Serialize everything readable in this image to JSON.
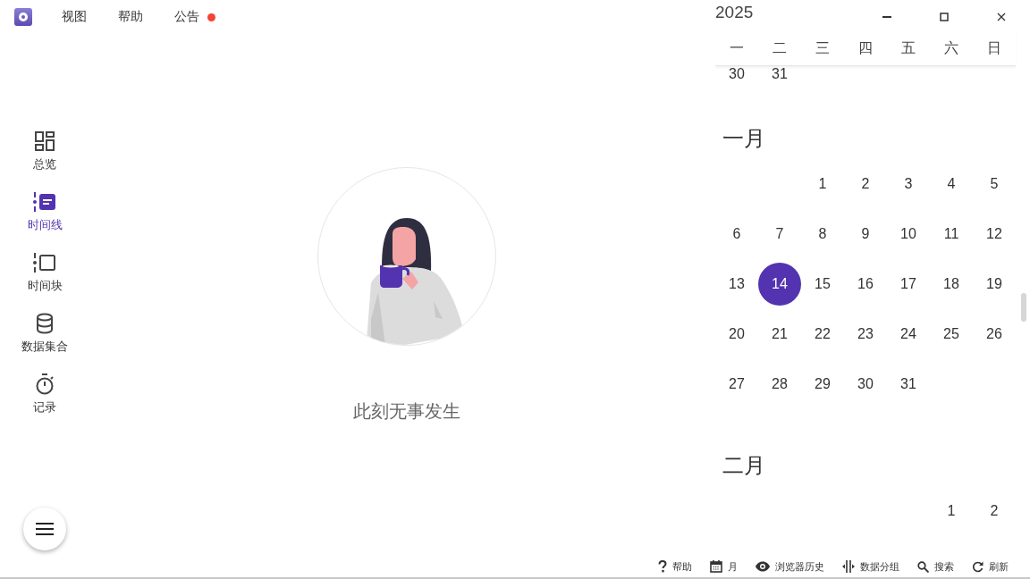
{
  "app_bar": {
    "menus": [
      {
        "label": "视图",
        "unread": false
      },
      {
        "label": "帮助",
        "unread": false
      },
      {
        "label": "公告",
        "unread": true
      }
    ]
  },
  "sidebar": {
    "items": [
      {
        "label": "总览",
        "selected": false
      },
      {
        "label": "时间线",
        "selected": true
      },
      {
        "label": "时间块",
        "selected": false
      },
      {
        "label": "数据集合",
        "selected": false
      },
      {
        "label": "记录",
        "selected": false
      }
    ]
  },
  "empty_state": {
    "message": "此刻无事发生"
  },
  "calendar": {
    "year": "2025",
    "weekdays": [
      "一",
      "二",
      "三",
      "四",
      "五",
      "六",
      "日"
    ],
    "leading_days": [
      {
        "day": "30",
        "selected": false
      },
      {
        "day": "31",
        "selected": false
      }
    ],
    "months": [
      {
        "name": "一月",
        "weeks": [
          [
            {
              "day": "1",
              "selected": false
            },
            {
              "day": "2",
              "selected": false
            },
            {
              "day": "3",
              "selected": false
            },
            {
              "day": "4",
              "selected": false
            },
            {
              "day": "5",
              "selected": false
            }
          ],
          [
            {
              "day": "6",
              "selected": false
            },
            {
              "day": "7",
              "selected": false
            },
            {
              "day": "8",
              "selected": false
            },
            {
              "day": "9",
              "selected": false
            },
            {
              "day": "10",
              "selected": false
            },
            {
              "day": "11",
              "selected": false
            },
            {
              "day": "12",
              "selected": false
            }
          ],
          [
            {
              "day": "13",
              "selected": false
            },
            {
              "day": "14",
              "selected": true
            },
            {
              "day": "15",
              "selected": false
            },
            {
              "day": "16",
              "selected": false
            },
            {
              "day": "17",
              "selected": false
            },
            {
              "day": "18",
              "selected": false
            },
            {
              "day": "19",
              "selected": false
            }
          ],
          [
            {
              "day": "20",
              "selected": false
            },
            {
              "day": "21",
              "selected": false
            },
            {
              "day": "22",
              "selected": false
            },
            {
              "day": "23",
              "selected": false
            },
            {
              "day": "24",
              "selected": false
            },
            {
              "day": "25",
              "selected": false
            },
            {
              "day": "26",
              "selected": false
            }
          ],
          [
            {
              "day": "27",
              "selected": false
            },
            {
              "day": "28",
              "selected": false
            },
            {
              "day": "29",
              "selected": false
            },
            {
              "day": "30",
              "selected": false
            },
            {
              "day": "31",
              "selected": false
            }
          ]
        ]
      },
      {
        "name": "二月",
        "weeks": [
          [
            {
              "day": "1",
              "selected": false
            },
            {
              "day": "2",
              "selected": false
            }
          ]
        ]
      }
    ]
  },
  "toolbar": {
    "items": [
      {
        "label": "帮助"
      },
      {
        "label": "月"
      },
      {
        "label": "浏览器历史"
      },
      {
        "label": "数据分组"
      },
      {
        "label": "搜索"
      },
      {
        "label": "刷新"
      }
    ]
  }
}
